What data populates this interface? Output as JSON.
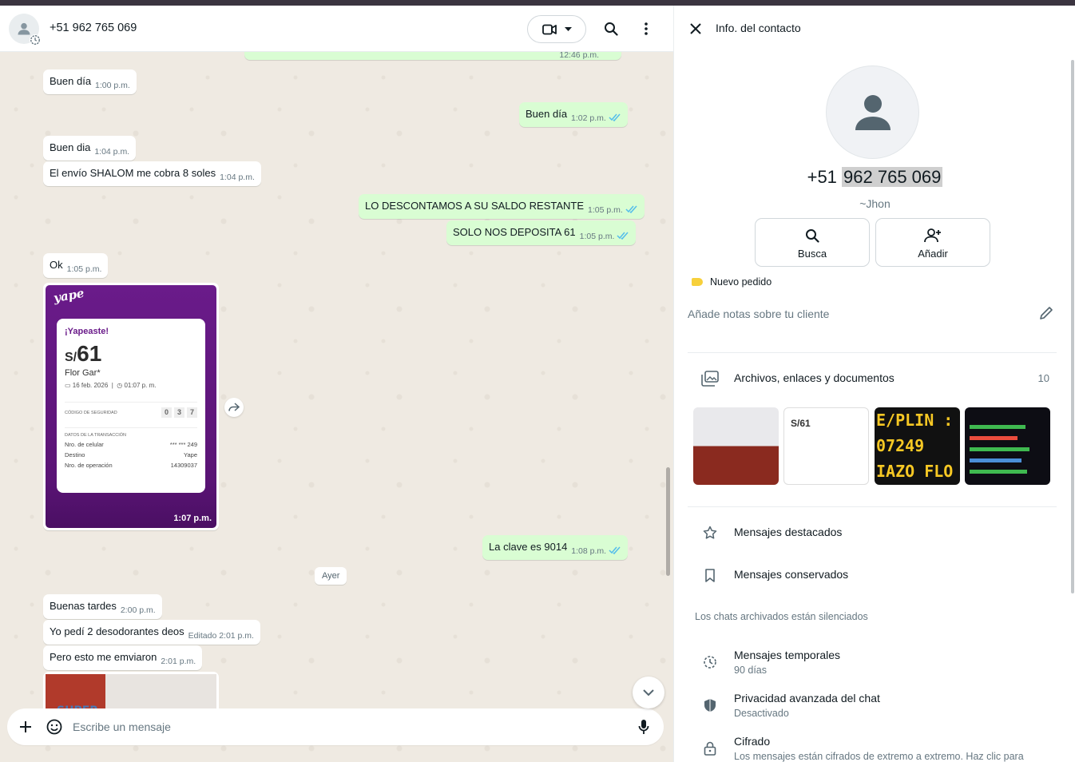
{
  "chat": {
    "contact_name": "+51 962 765 069",
    "composer_placeholder": "Escribe un mensaje",
    "day_separator": "Ayer",
    "messages": [
      {
        "text": "Buen día",
        "time": "1:00 p.m."
      },
      {
        "text": "Buen día",
        "time": "1:02 p.m."
      },
      {
        "text": "Buen dia",
        "time": "1:04 p.m."
      },
      {
        "text": "El envío SHALOM me cobra 8 soles",
        "time": "1:04 p.m."
      },
      {
        "text": "LO DESCONTAMOS A SU SALDO RESTANTE",
        "time": "1:05 p.m."
      },
      {
        "text": "SOLO NOS DEPOSITA 61",
        "time": "1:05 p.m."
      },
      {
        "text": "Ok",
        "time": "1:05 p.m."
      },
      {
        "text": "La clave es 9014",
        "time": "1:08 p.m."
      },
      {
        "text": "Buenas tardes",
        "time": "2:00 p.m."
      },
      {
        "text": "Yo pedí 2 desodorantes  deos",
        "time": "Editado 2:01 p.m."
      },
      {
        "text": "Pero esto me emviaron",
        "time": "2:01 p.m."
      }
    ],
    "top_partial_time": "12:46 p.m.",
    "yape_image": {
      "logo": "yape",
      "title": "¡Yapeaste!",
      "currency": "S/",
      "amount": "61",
      "name": "Flor Gar*",
      "date": "16 feb. 2026",
      "hour": "01:07 p. m.",
      "security_label": "CÓDIGO DE SEGURIDAD",
      "security_code": [
        "0",
        "3",
        "7"
      ],
      "details_header": "DATOS DE LA TRANSACCIÓN",
      "rows": [
        {
          "k": "Nro. de celular",
          "v": "*** *** 249"
        },
        {
          "k": "Destino",
          "v": "Yape"
        },
        {
          "k": "Nro. de operación",
          "v": "14309037"
        }
      ],
      "time": "1:07 p.m."
    },
    "image2_label": "SUPER"
  },
  "info": {
    "title": "Info. del contacto",
    "phone_prefix": "+51",
    "phone_rest": "962 765 069",
    "alias": "~Jhon",
    "search_label": "Busca",
    "add_label": "Añadir",
    "label_tag": "Nuevo pedido",
    "notes_placeholder": "Añade notas sobre tu cliente",
    "files_label": "Archivos, enlaces y documentos",
    "files_count": "10",
    "thumb2_amount": "S/61",
    "thumb3_lines": [
      "E/PLIN :",
      "07249",
      "IAZO FLO"
    ],
    "starred": "Mensajes destacados",
    "kept": "Mensajes conservados",
    "archived_note": "Los chats archivados están silenciados",
    "temp_title": "Mensajes temporales",
    "temp_sub": "90 días",
    "privacy_title": "Privacidad avanzada del chat",
    "privacy_sub": "Desactivado",
    "cipher_title": "Cifrado",
    "cipher_sub": "Los mensajes están cifrados de extremo a extremo. Haz clic para"
  },
  "colors": {
    "outgoing_bubble": "#d9fdd3",
    "incoming_bubble": "#ffffff",
    "chat_background": "#efeae2",
    "read_tick": "#53bdeb",
    "tag_yellow": "#f7d03b",
    "yape_purple": "#6a1b8a"
  }
}
